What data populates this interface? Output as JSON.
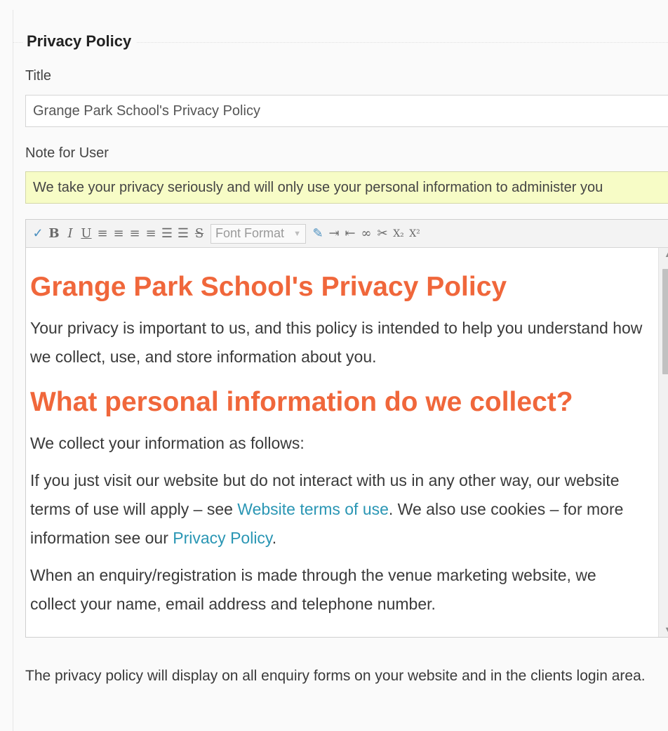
{
  "section": {
    "title": "Privacy Policy"
  },
  "title_field": {
    "label": "Title",
    "value": "Grange Park School's Privacy Policy"
  },
  "note_field": {
    "label": "Note for User",
    "value": "We take your privacy seriously and will only use your personal information to administer you"
  },
  "editor": {
    "toolbar": {
      "buttons": [
        {
          "name": "spellcheck-icon",
          "glyph": "✓"
        },
        {
          "name": "bold-icon",
          "glyph": "B"
        },
        {
          "name": "italic-icon",
          "glyph": "I"
        },
        {
          "name": "underline-icon",
          "glyph": "U"
        },
        {
          "name": "align-left-icon",
          "glyph": "≡"
        },
        {
          "name": "align-center-icon",
          "glyph": "≡"
        },
        {
          "name": "align-right-icon",
          "glyph": "≡"
        },
        {
          "name": "align-justify-icon",
          "glyph": "≡"
        },
        {
          "name": "ordered-list-icon",
          "glyph": "☰"
        },
        {
          "name": "unordered-list-icon",
          "glyph": "☰"
        },
        {
          "name": "strikethrough-icon",
          "glyph": "S"
        }
      ],
      "format_select": "Font Format",
      "buttons_after": [
        {
          "name": "edit-html-icon",
          "glyph": "✎"
        },
        {
          "name": "indent-icon",
          "glyph": "⇥"
        },
        {
          "name": "outdent-icon",
          "glyph": "⇤"
        },
        {
          "name": "insert-link-icon",
          "glyph": "∞"
        },
        {
          "name": "unlink-icon",
          "glyph": "✂"
        },
        {
          "name": "subscript-icon",
          "glyph": "X₂"
        },
        {
          "name": "superscript-icon",
          "glyph": "X²"
        }
      ]
    },
    "heading1": "Grange Park School's Privacy Policy",
    "intro": "Your privacy is important to us, and this policy is intended to help you understand how we collect, use, and store information about you.",
    "heading2": "What personal information do we collect?",
    "collect_intro": "We collect your information as follows:",
    "para1_a": " If you just visit our website but do not interact with us in any other way, our website terms of use will apply – see ",
    "para1_link1": "Website terms of use",
    "para1_b": ". We also use cookies – for more information see our ",
    "para1_link2": "Privacy Policy",
    "para1_c": ".",
    "para2": " When an enquiry/registration is made through the venue marketing website, we collect your name, email address and telephone number."
  },
  "help_text": "The privacy policy will display on all enquiry forms on your website and in the clients login area."
}
